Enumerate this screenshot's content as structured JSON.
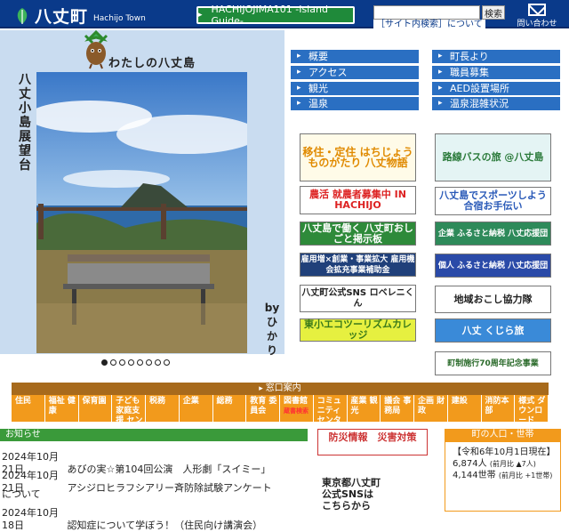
{
  "header": {
    "logo_text": "八丈町",
    "logo_sub": "Hachijo Town",
    "guide_label": "HACHIJOJIMA101 -Island Guide-",
    "search_button": "検索",
    "search_link": "［サイト内検索］について",
    "contact_label": "問い合わせ"
  },
  "hero": {
    "title": "わたしの八丈島",
    "vertical_title": "八丈小島展望台",
    "byline": "by ひかり",
    "slide_count": 8,
    "active_slide": 1
  },
  "menu_left": [
    "概要",
    "アクセス",
    "観光",
    "温泉"
  ],
  "menu_right": [
    "町長より",
    "職員募集",
    "AED設置場所",
    "温泉混雑状況"
  ],
  "banners_left": [
    "移住・定住 はちじょうものがたり 八丈物語",
    "農活 就農者募集中 IN HACHIJO",
    "八丈島で働く 八丈町おしごと掲示板",
    "雇用増×創業・事業拡大 雇用機会拡充事業補助金",
    "八丈町公式SNS ロベレニくん",
    "東小エコツーリズムカレッジ"
  ],
  "banners_right": [
    "路線バスの旅 @八丈島",
    "八丈島でスポーツしよう 合宿お手伝い",
    "企業 ふるさと納税 八丈応援団",
    "個人 ふるさと納税 八丈応援団",
    "地域おこし協力隊",
    "八丈 くじら旅",
    "町制施行70周年記念事業"
  ],
  "madoguchi": "窓口案内",
  "tabs": [
    {
      "label": "住民",
      "sub": ""
    },
    {
      "label": "福祉 健康",
      "sub": ""
    },
    {
      "label": "保育園",
      "sub": ""
    },
    {
      "label": "子ども 家庭支援 センター",
      "sub": ""
    },
    {
      "label": "税務",
      "sub": ""
    },
    {
      "label": "企業",
      "sub": ""
    },
    {
      "label": "総務",
      "sub": ""
    },
    {
      "label": "教育 委員会",
      "sub": ""
    },
    {
      "label": "図書館",
      "sub": "蔵書検索"
    },
    {
      "label": "コミュニティ センター",
      "sub": ""
    },
    {
      "label": "産業 観光",
      "sub": ""
    },
    {
      "label": "議会 事務局",
      "sub": ""
    },
    {
      "label": "企画 財政",
      "sub": ""
    },
    {
      "label": "建設",
      "sub": ""
    },
    {
      "label": "消防本部",
      "sub": ""
    },
    {
      "label": "様式 ダウンロード",
      "sub": ""
    }
  ],
  "news": {
    "heading": "お知らせ",
    "items": [
      {
        "date": "2024年10月21日",
        "text": "あびの実☆第104回公演　人形劇「スイミー」"
      },
      {
        "date": "2024年10月21日",
        "text": "アシジロヒラフシアリー斉防除試験アンケート"
      },
      {
        "date": "",
        "text": "について"
      },
      {
        "date": "2024年10月18日",
        "text": "認知症について学ぼう！（住民向け講演会）"
      }
    ]
  },
  "bousai": "防災情報　災害対策",
  "sns_text": "東京都八丈町 公式SNSは こちらから",
  "population": {
    "heading": "町の人口・世帯",
    "date": "【令和6年10月1日現在】",
    "people": "6,874人",
    "people_note": "(前月比 ▲7人)",
    "households": "4,144世帯",
    "households_note": "(前月比 +1世帯)"
  }
}
